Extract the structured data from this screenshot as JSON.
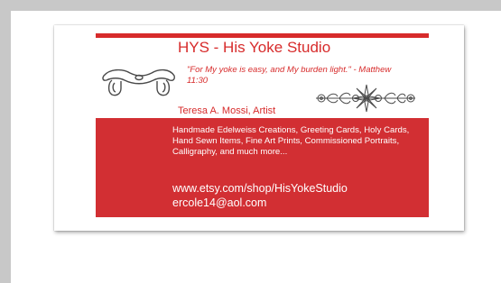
{
  "colors": {
    "frame": "#c8c8c8",
    "card_red": "#d72b2b",
    "panel_red": "#d22f33",
    "line_art": "#4a4a4a"
  },
  "card": {
    "title": "HYS - His Yoke Studio",
    "quote": "\"For My yoke is easy, and My burden light.\" - Matthew 11:30",
    "artist": "Teresa A. Mossi, Artist",
    "description": "Handmade Edelweiss Creations, Greeting Cards, Holy Cards, Hand Sewn Items, Fine Art Prints, Commissioned Portraits, Calligraphy, and much more...",
    "url": "www.etsy.com/shop/HisYokeStudio",
    "email": "ercole14@aol.com"
  },
  "icons": {
    "yoke": "yoke-drawing",
    "flowers": "edelweiss-flower-drawing"
  }
}
